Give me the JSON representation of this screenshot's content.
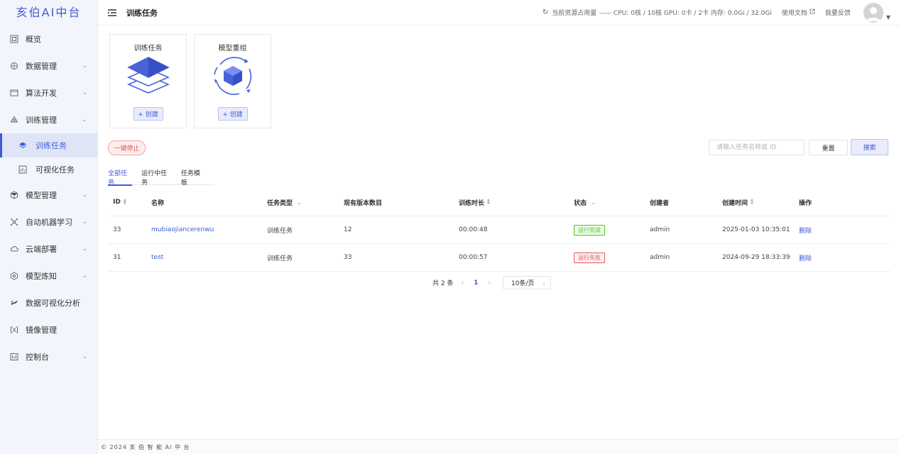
{
  "app": {
    "logo": "亥伯AI中台"
  },
  "sidebar": {
    "items": [
      {
        "label": "概览",
        "icon": "overview-icon"
      },
      {
        "label": "数据管理",
        "icon": "database-icon",
        "expandable": true
      },
      {
        "label": "算法开发",
        "icon": "code-icon",
        "expandable": true
      },
      {
        "label": "训练管理",
        "icon": "training-icon",
        "expandable": true,
        "expanded": true
      },
      {
        "label": "模型管理",
        "icon": "model-icon",
        "expandable": true
      },
      {
        "label": "自动机器学习",
        "icon": "automl-icon",
        "expandable": true
      },
      {
        "label": "云端部署",
        "icon": "cloud-icon",
        "expandable": true
      },
      {
        "label": "模型炼知",
        "icon": "knowledge-icon",
        "expandable": true
      },
      {
        "label": "数据可视化分析",
        "icon": "analysis-icon"
      },
      {
        "label": "镜像管理",
        "icon": "image-icon"
      },
      {
        "label": "控制台",
        "icon": "console-icon",
        "expandable": true
      }
    ],
    "sub_items": [
      {
        "label": "训练任务",
        "active": true
      },
      {
        "label": "可视化任务",
        "active": false
      }
    ]
  },
  "header": {
    "title": "训练任务",
    "resource_text": "当前资源占用量 —— CPU: 0核 / 10核 GPU: 0卡 / 2卡 内存: 0.0Gi / 32.0Gi",
    "docs_label": "使用文档",
    "feedback_label": "我要反馈"
  },
  "cards": [
    {
      "title": "训练任务",
      "create_label": "+ 创建"
    },
    {
      "title": "模型重组",
      "create_label": "+ 创建"
    }
  ],
  "toolbar": {
    "stop_label": "一键停止",
    "search_placeholder": "请输入任务名称或 ID",
    "reset_label": "重置",
    "search_label": "搜索"
  },
  "tabs": [
    "全部任务",
    "运行中任务",
    "任务模板"
  ],
  "table": {
    "columns": [
      "ID",
      "名称",
      "任务类型",
      "现有版本数目",
      "训练时长",
      "状态",
      "创建者",
      "创建时间",
      "操作"
    ],
    "rows": [
      {
        "id": "33",
        "name": "mubiaojiancerenwu",
        "type": "训练任务",
        "versions": "12",
        "duration": "00:00:48",
        "status": "运行完成",
        "status_kind": "success",
        "creator": "admin",
        "created": "2025-01-03 10:35:01",
        "action": "删除"
      },
      {
        "id": "31",
        "name": "test",
        "type": "训练任务",
        "versions": "33",
        "duration": "00:00:57",
        "status": "运行失败",
        "status_kind": "error",
        "creator": "admin",
        "created": "2024-09-29 18:33:39",
        "action": "删除"
      }
    ]
  },
  "pagination": {
    "total": "共 2 条",
    "current": "1",
    "page_size": "10条/页"
  },
  "footer": {
    "text": "© 2024 亥 伯 智 能 AI 中 台"
  },
  "colors": {
    "accent": "#3e5bd6",
    "success": "#52c41a",
    "error": "#e45656"
  }
}
